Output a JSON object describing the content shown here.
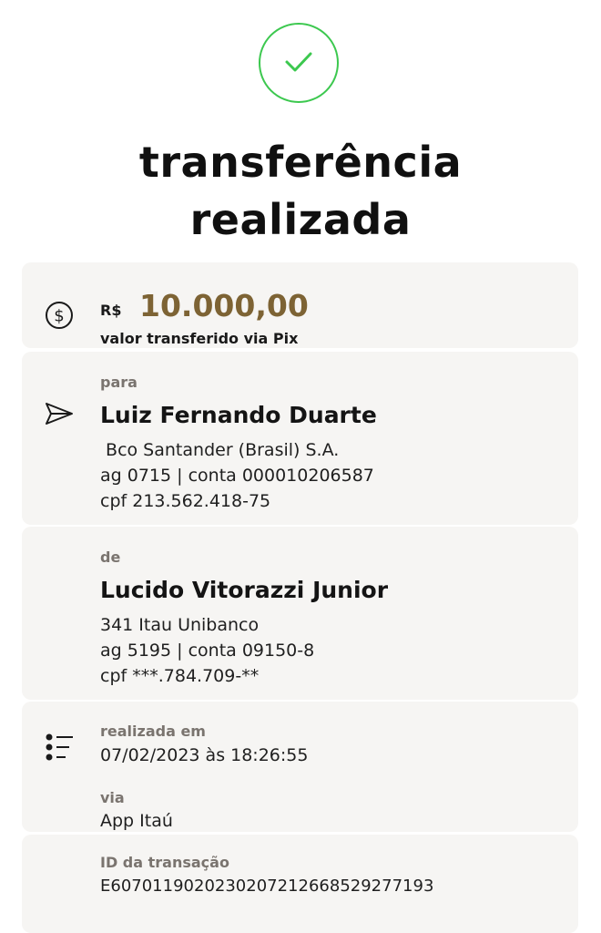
{
  "header": {
    "title_line1": "transferência",
    "title_line2": "realizada",
    "success_color": "#3cc84f",
    "icon": "check-icon"
  },
  "amount": {
    "icon": "dollar-circle-icon",
    "currency": "R$",
    "value": "10.000,00",
    "caption": "valor transferido via Pix",
    "value_color": "#7d6334"
  },
  "recipient": {
    "icon": "send-icon",
    "label": "para",
    "name": "Luiz Fernando Duarte",
    "bank": " Bco Santander (Brasil) S.A.",
    "account": "ag 0715 | conta 000010206587",
    "document": "cpf 213.562.418-75"
  },
  "sender": {
    "label": "de",
    "name": "Lucido Vitorazzi Junior",
    "bank": "341 Itau Unibanco",
    "account": "ag 5195 | conta 09150-8",
    "document": "cpf ***.784.709-**"
  },
  "details": {
    "icon": "list-icon",
    "date_label": "realizada em",
    "date_value": "07/02/2023 às 18:26:55",
    "via_label": "via",
    "via_value": "App Itaú"
  },
  "transaction": {
    "id_label": "ID da transação",
    "id_value": "E60701190202302072126685292771​93"
  }
}
